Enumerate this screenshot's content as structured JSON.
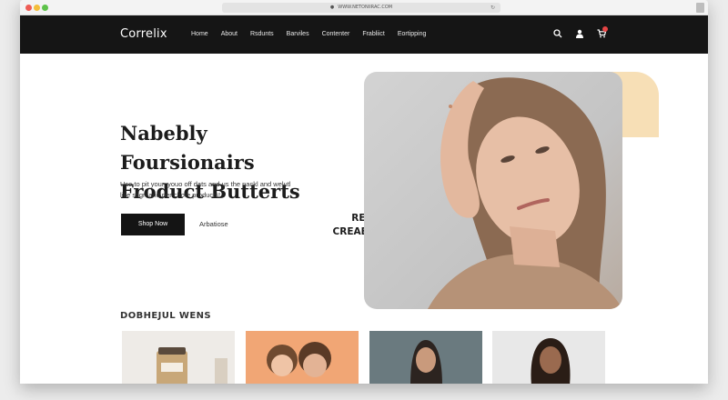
{
  "browser": {
    "url": "WWW.NETONIIRAC.COM"
  },
  "nav": {
    "logo": "Correlix",
    "links": [
      "Home",
      "About",
      "Rsdunts",
      "Barviles",
      "Contenter",
      "Frabliict",
      "Eortipping"
    ],
    "icons": [
      "search-icon",
      "user-icon",
      "cart-icon"
    ]
  },
  "hero": {
    "title_line1": "Nabebly Foursionairs",
    "title_line2": "Froduct Butterts",
    "description": "Use to pit your, youo off dats and us the packl and welutl like stign and per chote products!",
    "primary_button": "Shop Now",
    "secondary_link": "Arbatiose",
    "side_text_line1": "REIMI",
    "side_text_line2": "CREABUCTY!"
  },
  "section": {
    "title": "DOBHEJUL WENS"
  },
  "colors": {
    "nav_background": "#151515",
    "accent_peach": "#f7dfb6",
    "button_background": "#141414"
  }
}
